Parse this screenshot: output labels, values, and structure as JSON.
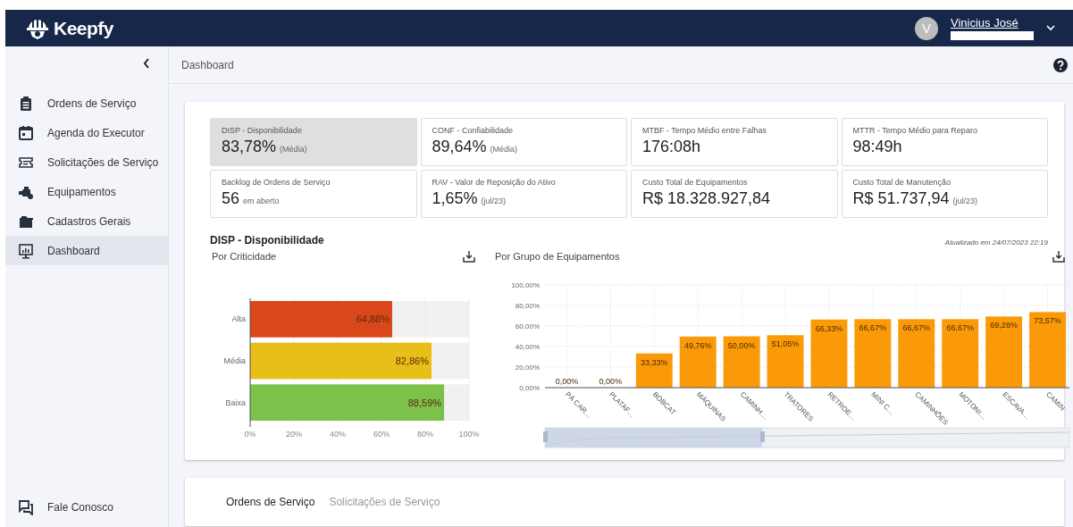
{
  "header": {
    "brand": "Keepfy",
    "user": {
      "initial": "V",
      "name": "Vinicius José"
    }
  },
  "sidebar": {
    "items": [
      {
        "label": "Ordens de Serviço",
        "kind": "clipboard",
        "selected": false
      },
      {
        "label": "Agenda do Executor",
        "kind": "calendar",
        "selected": false
      },
      {
        "label": "Solicitações de Serviço",
        "kind": "ticket",
        "selected": false
      },
      {
        "label": "Equipamentos",
        "kind": "engine",
        "selected": false
      },
      {
        "label": "Cadastros Gerais",
        "kind": "folder",
        "selected": false
      },
      {
        "label": "Dashboard",
        "kind": "monitor",
        "selected": true
      }
    ],
    "footer": {
      "label": "Fale Conosco"
    }
  },
  "breadcrumb": "Dashboard",
  "kpis": [
    {
      "title": "DISP - Disponibilidade",
      "value": "83,78%",
      "note": "(Média)",
      "selected": true
    },
    {
      "title": "CONF - Confiabilidade",
      "value": "89,64%",
      "note": "(Média)",
      "selected": false
    },
    {
      "title": "MTBF - Tempo Médio entre Falhas",
      "value": "176:08h",
      "selected": false
    },
    {
      "title": "MTTR - Tempo Médio para Reparo",
      "value": "98:49h",
      "selected": false
    },
    {
      "title": "Backlog de Ordens de Serviço",
      "value": "56",
      "note": "em aberto",
      "selected": false
    },
    {
      "title": "RAV - Valor de Reposição do Ativo",
      "value": "1,65%",
      "note": "(jul/23)",
      "selected": false
    },
    {
      "title": "Custo Total de Equipamentos",
      "value": "R$ 18.328.927,84",
      "selected": false
    },
    {
      "title": "Custo Total de Manutenção",
      "value": "R$ 51.737,94",
      "note": "(jul/23)",
      "selected": false
    }
  ],
  "section": {
    "title": "DISP - Disponibilidade",
    "updated": "Atualizado em 24/07/2023 22:19",
    "charts": [
      {
        "subtitle": "Por Criticidade",
        "chart_data": {
          "type": "bar",
          "orientation": "horizontal",
          "categories": [
            "Alta",
            "Média",
            "Baixa"
          ],
          "values": [
            64.88,
            82.86,
            88.59
          ],
          "colors": [
            "#d9471b",
            "#e8be18",
            "#7cc14a"
          ],
          "grid": true,
          "xlim": [
            0,
            100
          ],
          "xticks": [
            {
              "value": 0,
              "label": "0%"
            },
            {
              "value": 20,
              "label": "20%"
            },
            {
              "value": 40,
              "label": "40%"
            },
            {
              "value": 60,
              "label": "60%"
            },
            {
              "value": 80,
              "label": "80%"
            },
            {
              "value": 100,
              "label": "100%"
            }
          ],
          "value_labels": [
            "64,88%",
            "82,86%",
            "88,59%"
          ]
        }
      },
      {
        "subtitle": "Por Grupo de Equipamentos",
        "chart_data": {
          "type": "bar",
          "orientation": "vertical",
          "categories": [
            "PÁ CAR…",
            "PLATAF…",
            "BOBCAT",
            "MÁQUINAS",
            "CAMINH…",
            "TRATORES",
            "RETROE…",
            "MINI C…",
            "CAMINHÕES",
            "MOTONI…",
            "ESCAVA…",
            "CAMIN"
          ],
          "values": [
            0,
            0,
            33.33,
            49.76,
            50,
            51.05,
            66.33,
            66.67,
            66.67,
            66.67,
            69.28,
            73.57
          ],
          "color": "#fb9a08",
          "grid": true,
          "ylim": [
            0,
            100
          ],
          "yticks": [
            {
              "value": 0,
              "label": "0,00%"
            },
            {
              "value": 20,
              "label": "20,00%"
            },
            {
              "value": 40,
              "label": "40,00%"
            },
            {
              "value": 60,
              "label": "60,00%"
            },
            {
              "value": 80,
              "label": "80,00%"
            },
            {
              "value": 100,
              "label": "100,00%"
            }
          ],
          "value_labels": [
            "0,00%",
            "0,00%",
            "33,33%",
            "49,76%",
            "50,00%",
            "51,05%",
            "66,33%",
            "66,67%",
            "66,67%",
            "66,67%",
            "69,28%",
            "73,57%"
          ]
        }
      }
    ]
  },
  "bottom_tabs": [
    {
      "label": "Ordens de Serviço",
      "selected": true
    },
    {
      "label": "Solicitações de Serviço",
      "selected": false
    }
  ]
}
